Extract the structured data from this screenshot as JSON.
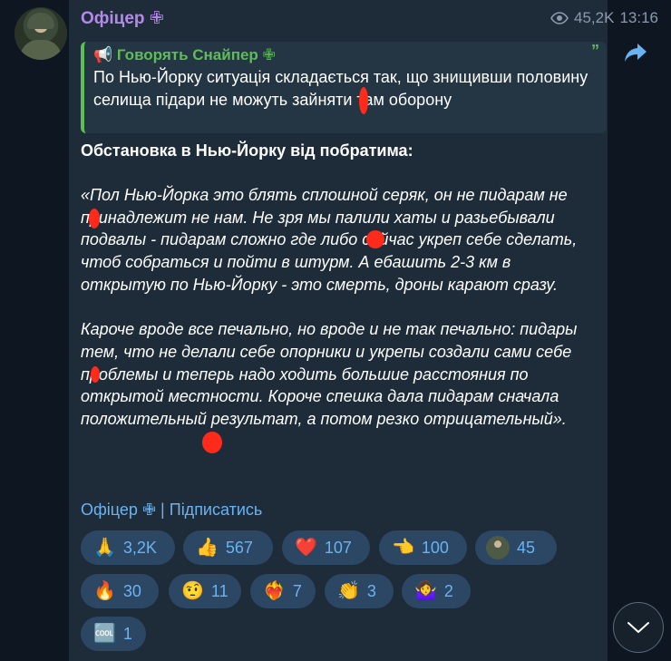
{
  "post": {
    "author": "Офіцер ✙",
    "views": "45,2K",
    "time": "13:16"
  },
  "reply": {
    "title": "📢 Говорять Снайпер ✙",
    "quote_mark": "”",
    "text": "По Нью-Йорку ситуація складається так, що знищивши половину селища підари не можуть зайняти там оборону"
  },
  "headline": "Обстановка в Нью-Йорку від побратима:",
  "quote": {
    "paragraph1": "«Пол Нью-Йорка это блять сплошной серяк, он не пидарам не принадлежит не нам. Не зря мы палили хаты и разьебывали подвалы - пидарам сложно где либо сейчас укреп себе сделать, чтоб собраться и пойти в штурм. А ебашить 2-3 км в открытую по Нью-Йорку -  это смерть, дроны карают сразу.",
    "paragraph2": "Кароче вроде все печально, но вроде и не так печально: пидары тем, что не делали себе опорники и укрепы создали сами себе проблемы и теперь надо ходить большие расстояния по открытой местности. Короче спешка дала пидарам сначала положительный результат, а потом резко отрицательный»."
  },
  "signature": {
    "channel": "Офіцер ✙",
    "separator": "|",
    "subscribe": "Підписатись"
  },
  "reactions": [
    {
      "emoji": "🙏",
      "count": "3,2K",
      "icon": "pray-icon"
    },
    {
      "emoji": "👍",
      "count": "567",
      "icon": "thumbs-up-icon"
    },
    {
      "emoji": "❤️",
      "count": "107",
      "icon": "heart-icon"
    },
    {
      "emoji": "👈",
      "count": "100",
      "icon": "pointing-hand-icon"
    },
    {
      "emoji": "",
      "count": "45",
      "icon": "channel-avatar-icon"
    },
    {
      "emoji": "🔥",
      "count": "30",
      "icon": "fire-icon"
    },
    {
      "emoji": "🤨",
      "count": "11",
      "icon": "raised-eyebrow-icon"
    },
    {
      "emoji": "❤️‍🔥",
      "count": "7",
      "icon": "heart-on-fire-icon"
    },
    {
      "emoji": "👏",
      "count": "3",
      "icon": "clapping-icon"
    },
    {
      "emoji": "🤷‍♀️",
      "count": "2",
      "icon": "shrug-icon"
    },
    {
      "emoji": "🆒",
      "count": "1",
      "icon": "cool-icon"
    }
  ],
  "colors": {
    "background": "#0e1621",
    "bubble": "#1e2c3a",
    "author": "#b38ae8",
    "reply_accent": "#5dbe55",
    "link": "#6ab3f3",
    "reaction_bg": "#2b4763",
    "censor_mark": "#ff2a1a"
  }
}
